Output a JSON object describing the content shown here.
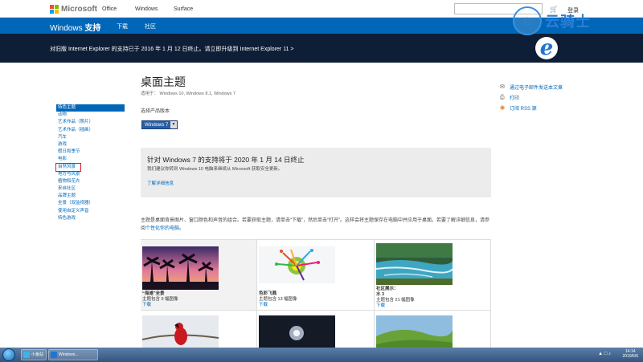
{
  "header": {
    "brand": "Microsoft",
    "nav": [
      "Office",
      "Windows",
      "Surface"
    ],
    "signin": "登录"
  },
  "subheader": {
    "brand_prefix": "Windows ",
    "brand_bold": "支持",
    "nav": [
      "下载",
      "社区"
    ]
  },
  "banner": {
    "message": "对旧版 Internet Explorer 的支持已于 2016 年 1 月 12 日终止。请立即升级到 Internet Explorer 11 >"
  },
  "watermark": {
    "text": "云骑士"
  },
  "page": {
    "title": "桌面主题",
    "applies_to": "适用于：   Windows 10, Windows 8.1, Windows 7"
  },
  "right_links": [
    {
      "icon": "mail-icon",
      "label": "通过电子邮件发送本文章"
    },
    {
      "icon": "print-icon",
      "label": "打印"
    },
    {
      "icon": "rss-icon",
      "label": "订阅 RSS 源"
    }
  ],
  "sidebar": {
    "items": [
      "特色主题",
      "动物",
      "艺术作品（照片）",
      "艺术作品（插画）",
      "汽车",
      "游戏",
      "假日和季节",
      "电影",
      "自然风景",
      "地方与风景",
      "植物和花卉",
      "来自社区",
      "品牌主题",
      "全景（双监视器）",
      "使用自定义声音",
      "特色游戏"
    ],
    "active_index": 0,
    "boxed_index": 8
  },
  "product": {
    "label": "选择产品版本",
    "selected": "Windows 7"
  },
  "notice": {
    "title": "针对 Windows 7 的支持将于 2020 年 1 月 14 日终止",
    "body": "我们建议你转到 Windows 10 电脑来继续从 Microsoft 获取安全更新。",
    "link": "了解详细信息"
  },
  "description": {
    "text": "主题是桌面背景图片、窗口颜色和声音的组合。若要获取主题，请单击“下载”，然后单击“打开”。这样会将主题保存在电脑中并应用于桌面。若要了解详细信息，请参阅",
    "link": "个性化你的电脑",
    "end": "。"
  },
  "themes": [
    {
      "title": "“海滩”全景",
      "count": "主题包含 9 幅图像",
      "download": "下载"
    },
    {
      "title": "色彩飞溅",
      "count": "主题包含 13 幅图像",
      "download": "下载"
    },
    {
      "title": "社区展示：",
      "title2": "水 3",
      "count": "主题包含 21 幅图像",
      "download": "下载"
    }
  ],
  "taskbar": {
    "items": [
      "小鱼站",
      "Windows..."
    ],
    "time": "14:14",
    "date": "2019/6/6"
  },
  "colors": {
    "brand_blue": "#0067b8",
    "dark_banner": "#0e1e36",
    "highlight_box": "#d0202a"
  }
}
